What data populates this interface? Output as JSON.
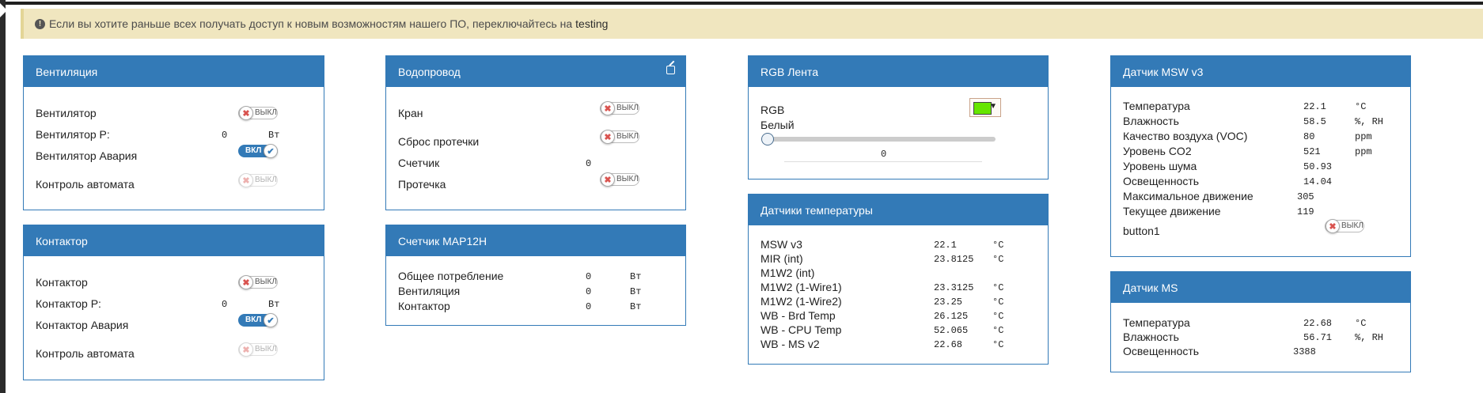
{
  "alert": {
    "text": "Если вы хотите раньше всех получать доступ к новым возможностям нашего ПО, переключайтесь на",
    "link": "testing"
  },
  "ventilation": {
    "title": "Вентиляция",
    "fan": {
      "label": "Вентилятор",
      "state": "ВЫКЛ"
    },
    "fan_power": {
      "label": "Вентилятор P:",
      "value": "0",
      "unit": "Вт"
    },
    "fan_alarm": {
      "label": "Вентилятор Авария",
      "state": "ВКЛ"
    },
    "auto_control": {
      "label": "Контроль автомата",
      "state": "ВЫКЛ"
    }
  },
  "contactor": {
    "title": "Контактор",
    "contactor": {
      "label": "Контактор",
      "state": "ВЫКЛ"
    },
    "contactor_power": {
      "label": "Контактор P:",
      "value": "0",
      "unit": "Вт"
    },
    "contactor_alarm": {
      "label": "Контактор Авария",
      "state": "ВКЛ"
    },
    "auto_control": {
      "label": "Контроль автомата",
      "state": "ВЫКЛ"
    }
  },
  "water": {
    "title": "Водопровод",
    "valve": {
      "label": "Кран",
      "state": "ВЫКЛ"
    },
    "leak_reset": {
      "label": "Сброс протечки",
      "state": "ВЫКЛ"
    },
    "counter": {
      "label": "Счетчик",
      "value": "0"
    },
    "leak": {
      "label": "Протечка",
      "state": "ВЫКЛ"
    }
  },
  "meter": {
    "title": "Счетчик MAP12H",
    "rows": [
      {
        "label": "Общее потребление",
        "value": "0",
        "unit": "Вт"
      },
      {
        "label": "Вентиляция",
        "value": "0",
        "unit": "Вт"
      },
      {
        "label": "Контактор",
        "value": "0",
        "unit": "Вт"
      }
    ]
  },
  "rgb": {
    "title": "RGB Лента",
    "rgb_label": "RGB",
    "color": "#66e600",
    "white_label": "Белый",
    "white_value": "0",
    "white_level": 0
  },
  "temps": {
    "title": "Датчики температуры",
    "rows": [
      {
        "label": "MSW v3",
        "value": "22.1",
        "unit": "°C"
      },
      {
        "label": "MIR (int)",
        "value": "23.8125",
        "unit": "°C"
      },
      {
        "label": "M1W2 (int)",
        "value": "",
        "unit": ""
      },
      {
        "label": "M1W2 (1-Wire1)",
        "value": "23.3125",
        "unit": "°C"
      },
      {
        "label": "M1W2 (1-Wire2)",
        "value": "23.25",
        "unit": "°C"
      },
      {
        "label": "WB - Brd Temp",
        "value": "26.125",
        "unit": "°C"
      },
      {
        "label": "WB - CPU Temp",
        "value": "52.065",
        "unit": "°C"
      },
      {
        "label": "WB - MS v2",
        "value": "22.68",
        "unit": "°C"
      }
    ]
  },
  "msw": {
    "title": "Датчик MSW v3",
    "rows": [
      {
        "label": "Температура",
        "value": "22.1",
        "unit": "°C"
      },
      {
        "label": "Влажность",
        "value": "58.5",
        "unit": "%, RH"
      },
      {
        "label": "Качество воздуха (VOC)",
        "value": "80",
        "unit": "ppm"
      },
      {
        "label": "Уровень CO2",
        "value": "521",
        "unit": "ppm"
      },
      {
        "label": "Уровень шума",
        "value": "50.93",
        "unit": ""
      },
      {
        "label": "Освещенность",
        "value": "14.04",
        "unit": ""
      },
      {
        "label": "Максимальное движение",
        "value": "305",
        "unit": ""
      },
      {
        "label": "Текущее движение",
        "value": "119",
        "unit": ""
      }
    ],
    "button1": {
      "label": "button1",
      "state": "ВЫКЛ"
    }
  },
  "ms": {
    "title": "Датчик MS",
    "rows": [
      {
        "label": "Температура",
        "value": "22.68",
        "unit": "°C"
      },
      {
        "label": "Влажность",
        "value": "56.71",
        "unit": "%, RH"
      },
      {
        "label": "Освещенность",
        "value": "3388",
        "unit": ""
      }
    ]
  }
}
